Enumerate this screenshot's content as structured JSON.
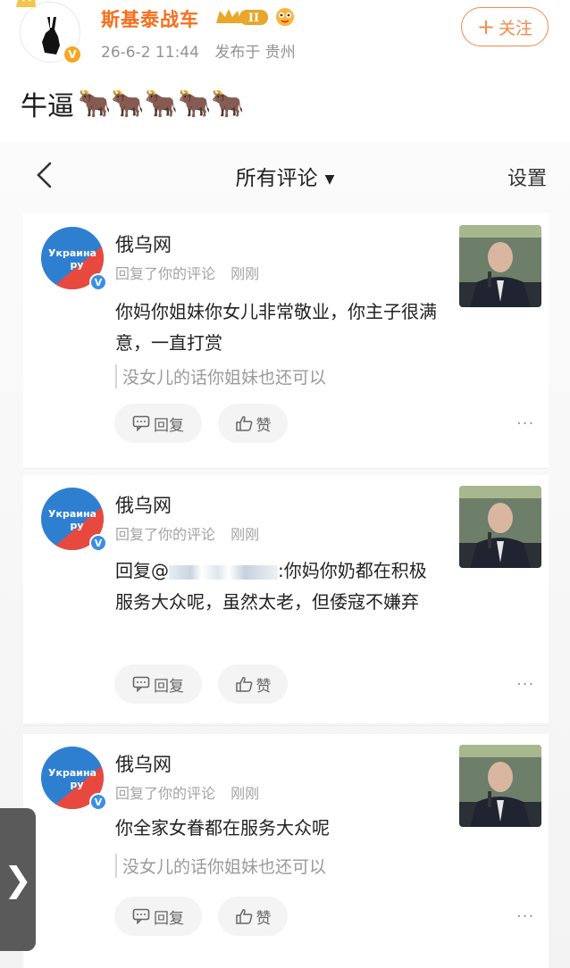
{
  "post": {
    "author": "斯基泰战车",
    "vip_level": "II",
    "verified_mark": "V",
    "time": "26-6-2 11:44",
    "source": "发布于 贵州",
    "follow_label": "关注",
    "text": "牛逼",
    "emojis": "🐂🐂🐂🐂🐂"
  },
  "screenshot": {
    "nav": {
      "title": "所有评论",
      "caret": "▼",
      "settings": "设置"
    },
    "comments": [
      {
        "user": "俄乌网",
        "action": "回复了你的评论",
        "time": "刚刚",
        "body": "你妈你姐妹你女儿非常敬业，你主子很满意，一直打赏",
        "quote": "没女儿的话你姐妹也还可以",
        "reply_label": "回复",
        "like_label": "赞",
        "more": "···"
      },
      {
        "user": "俄乌网",
        "action": "回复了你的评论",
        "time": "刚刚",
        "body_prefix": "回复@",
        "body": ":你妈你奶都在积极服务大众呢，虽然太老，但倭寇不嫌弃",
        "reply_label": "回复",
        "like_label": "赞",
        "more": "···"
      },
      {
        "user": "俄乌网",
        "action": "回复了你的评论",
        "time": "刚刚",
        "body": "你全家女眷都在服务大众呢",
        "quote": "没女儿的话你姐妹也还可以",
        "reply_label": "回复",
        "like_label": "赞",
        "more": "···"
      }
    ],
    "avatar_text_line1": "Украина",
    "avatar_text_line2": "ру"
  },
  "side_arrow": "❯",
  "colors": {
    "brand_orange": "#f76e1b",
    "follow_orange": "#f5894b",
    "avatar_blue": "#2f7fd1",
    "avatar_red": "#e8493f"
  }
}
